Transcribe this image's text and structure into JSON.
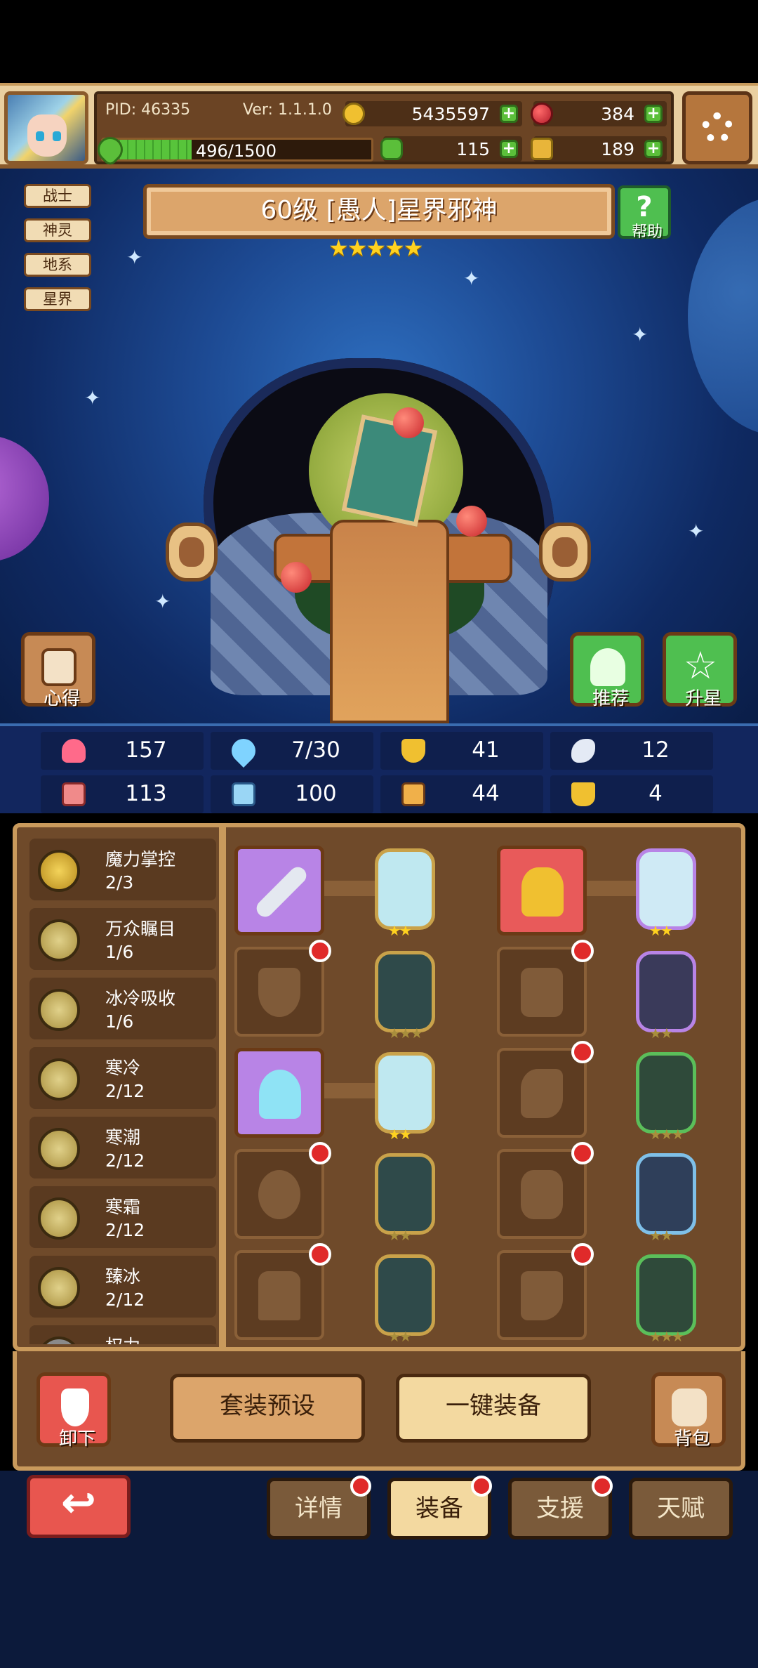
{
  "header": {
    "pid": "PID: 46335",
    "version": "Ver: 1.1.1.0",
    "gold": "5435597",
    "gems": "384",
    "exp": "496/1500",
    "clover": "115",
    "key": "189",
    "exp_progress": 0.33
  },
  "scene": {
    "tags": [
      "战士",
      "神灵",
      "地系",
      "星界"
    ],
    "title": "60级 [愚人]星界邪神",
    "stars": "★★★★★",
    "help_label": "帮助",
    "insight_label": "心得",
    "recommend_label": "推荐",
    "upgrade_star_label": "升星"
  },
  "stats": {
    "hp": "157",
    "mana": "7/30",
    "defense": "41",
    "wing": "12",
    "attack": "113",
    "book": "100",
    "chart": "44",
    "crown": "4"
  },
  "skills": [
    {
      "name": "魔力掌控",
      "level": "2/3"
    },
    {
      "name": "万众瞩目",
      "level": "1/6"
    },
    {
      "name": "冰冷吸收",
      "level": "1/6"
    },
    {
      "name": "寒冷",
      "level": "2/12"
    },
    {
      "name": "寒潮",
      "level": "2/12"
    },
    {
      "name": "寒霜",
      "level": "2/12"
    },
    {
      "name": "臻冰",
      "level": "2/12"
    },
    {
      "name": "权力",
      "level": ""
    }
  ],
  "buttons": {
    "unequip": "卸下",
    "set_preset": "套装预设",
    "one_click_equip": "一键装备",
    "backpack": "背包"
  },
  "tabs": {
    "details": "详情",
    "equipment": "装备",
    "support": "支援",
    "talent": "天赋"
  },
  "colors": {
    "accent": "#c99a5c",
    "panel": "#6f4a2a",
    "sky": "#1d4a93"
  }
}
